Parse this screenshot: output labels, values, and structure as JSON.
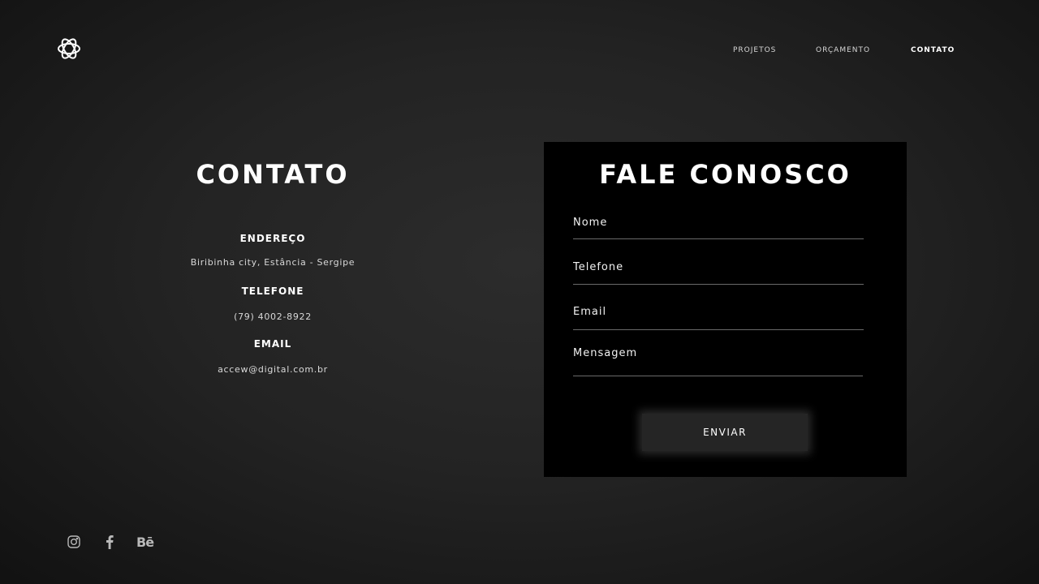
{
  "header": {
    "logo_icon": "knot-logo-icon",
    "nav": [
      {
        "label": "PROJETOS",
        "active": false
      },
      {
        "label": "ORÇAMENTO",
        "active": false
      },
      {
        "label": "CONTATO",
        "active": true
      }
    ]
  },
  "contact_info": {
    "title": "CONTATO",
    "address_label": "ENDEREÇO",
    "address_value": "Biribinha city, Estância - Sergipe",
    "phone_label": "TELEFONE",
    "phone_value": "(79) 4002-8922",
    "email_label": "EMAIL",
    "email_value": "accew@digital.com.br"
  },
  "form": {
    "title": "FALE CONOSCO",
    "name_placeholder": "Nome",
    "phone_placeholder": "Telefone",
    "email_placeholder": "Email",
    "message_placeholder": "Mensagem",
    "submit_label": "ENVIAR"
  },
  "social": {
    "icons": [
      "instagram-icon",
      "facebook-icon",
      "behance-icon"
    ],
    "behance_text": "Bē"
  },
  "colors": {
    "background": "#232323",
    "panel": "#000000",
    "text": "#ffffff",
    "button": "#252525"
  }
}
